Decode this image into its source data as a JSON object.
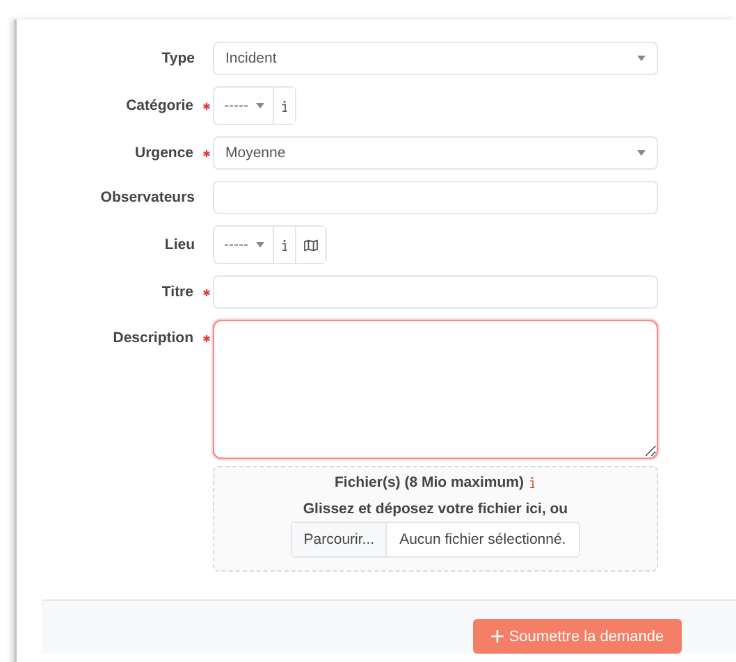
{
  "fields": [
    {
      "label": "Type",
      "required": false,
      "kind": "select",
      "value": "Incident"
    },
    {
      "label": "Catégorie",
      "required": true,
      "kind": "compact-select",
      "value": "-----",
      "map": false
    },
    {
      "label": "Urgence",
      "required": true,
      "kind": "select",
      "value": "Moyenne"
    },
    {
      "label": "Observateurs",
      "required": false,
      "kind": "text"
    },
    {
      "label": "Lieu",
      "required": false,
      "kind": "compact-select",
      "value": "-----",
      "map": true
    },
    {
      "label": "Titre",
      "required": true,
      "kind": "text"
    },
    {
      "label": "Description",
      "required": true,
      "kind": "textarea",
      "invalid": true
    }
  ],
  "upload": {
    "title": "Fichier(s) (8 Mio maximum)",
    "hint": "Glissez et déposez votre fichier ici, ou",
    "browse": "Parcourir...",
    "status": "Aucun fichier sélectionné."
  },
  "submit": {
    "label": "Soumettre la demande"
  }
}
